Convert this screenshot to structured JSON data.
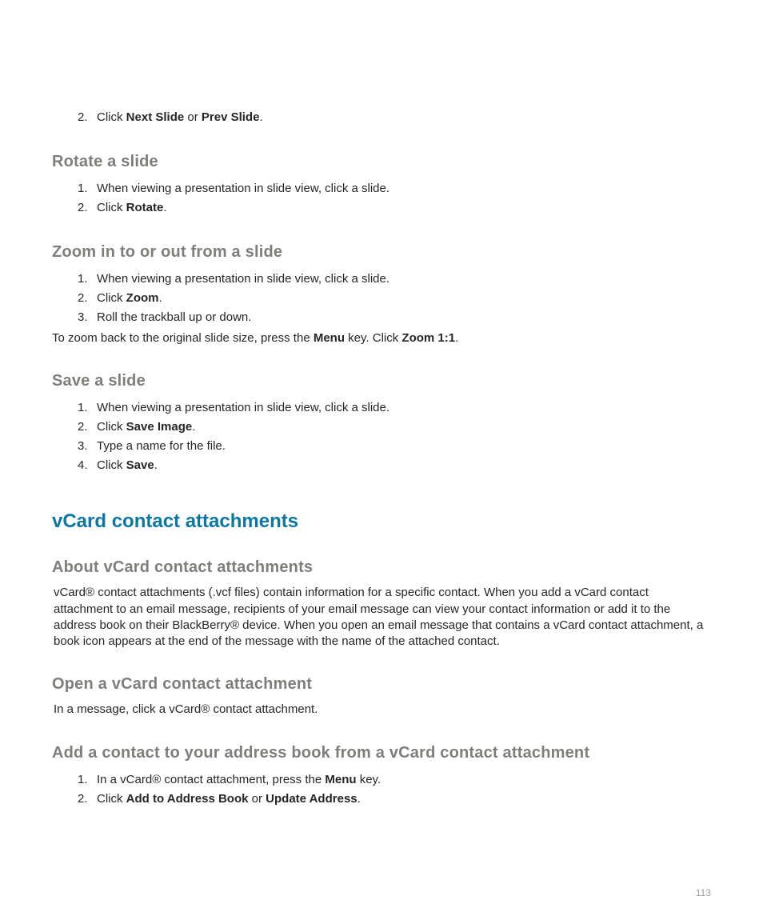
{
  "topList": {
    "item2_prefix": "Click ",
    "item2_bold1": "Next Slide",
    "item2_mid": " or ",
    "item2_bold2": "Prev Slide",
    "item2_suffix": "."
  },
  "rotate": {
    "heading": "Rotate a slide",
    "step1": "When viewing a presentation in slide view, click a slide.",
    "step2_prefix": "Click ",
    "step2_bold": "Rotate",
    "step2_suffix": "."
  },
  "zoom": {
    "heading": "Zoom in to or out from a slide",
    "step1": "When viewing a presentation in slide view, click a slide.",
    "step2_prefix": "Click ",
    "step2_bold": "Zoom",
    "step2_suffix": ".",
    "step3": "Roll the trackball up or down.",
    "after_prefix": "To zoom back to the original slide size, press the ",
    "after_bold1": "Menu",
    "after_mid": " key. Click ",
    "after_bold2": "Zoom 1:1",
    "after_suffix": "."
  },
  "save": {
    "heading": "Save a slide",
    "step1": "When viewing a presentation in slide view, click a slide.",
    "step2_prefix": "Click ",
    "step2_bold": "Save Image",
    "step2_suffix": ".",
    "step3": "Type a name for the file.",
    "step4_prefix": "Click ",
    "step4_bold": "Save",
    "step4_suffix": "."
  },
  "vcard": {
    "heading": "vCard contact attachments",
    "about_heading": "About vCard contact attachments",
    "about_body": "vCard® contact attachments (.vcf files) contain information for a specific contact. When you add a vCard contact attachment to an email message, recipients of your email message can view your contact information or add it to the address book on their BlackBerry® device. When you open an email message that contains a vCard contact attachment, a book icon appears at the end of the message with the name of the attached contact.",
    "open_heading": "Open a vCard contact attachment",
    "open_body": "In a message, click a vCard® contact attachment.",
    "add_heading": "Add a contact to your address book from a vCard contact attachment",
    "add_step1_prefix": "In a vCard® contact attachment, press the ",
    "add_step1_bold": "Menu",
    "add_step1_suffix": " key.",
    "add_step2_prefix": "Click ",
    "add_step2_bold1": "Add to Address Book",
    "add_step2_mid": " or ",
    "add_step2_bold2": "Update Address",
    "add_step2_suffix": "."
  },
  "page_number": "113"
}
